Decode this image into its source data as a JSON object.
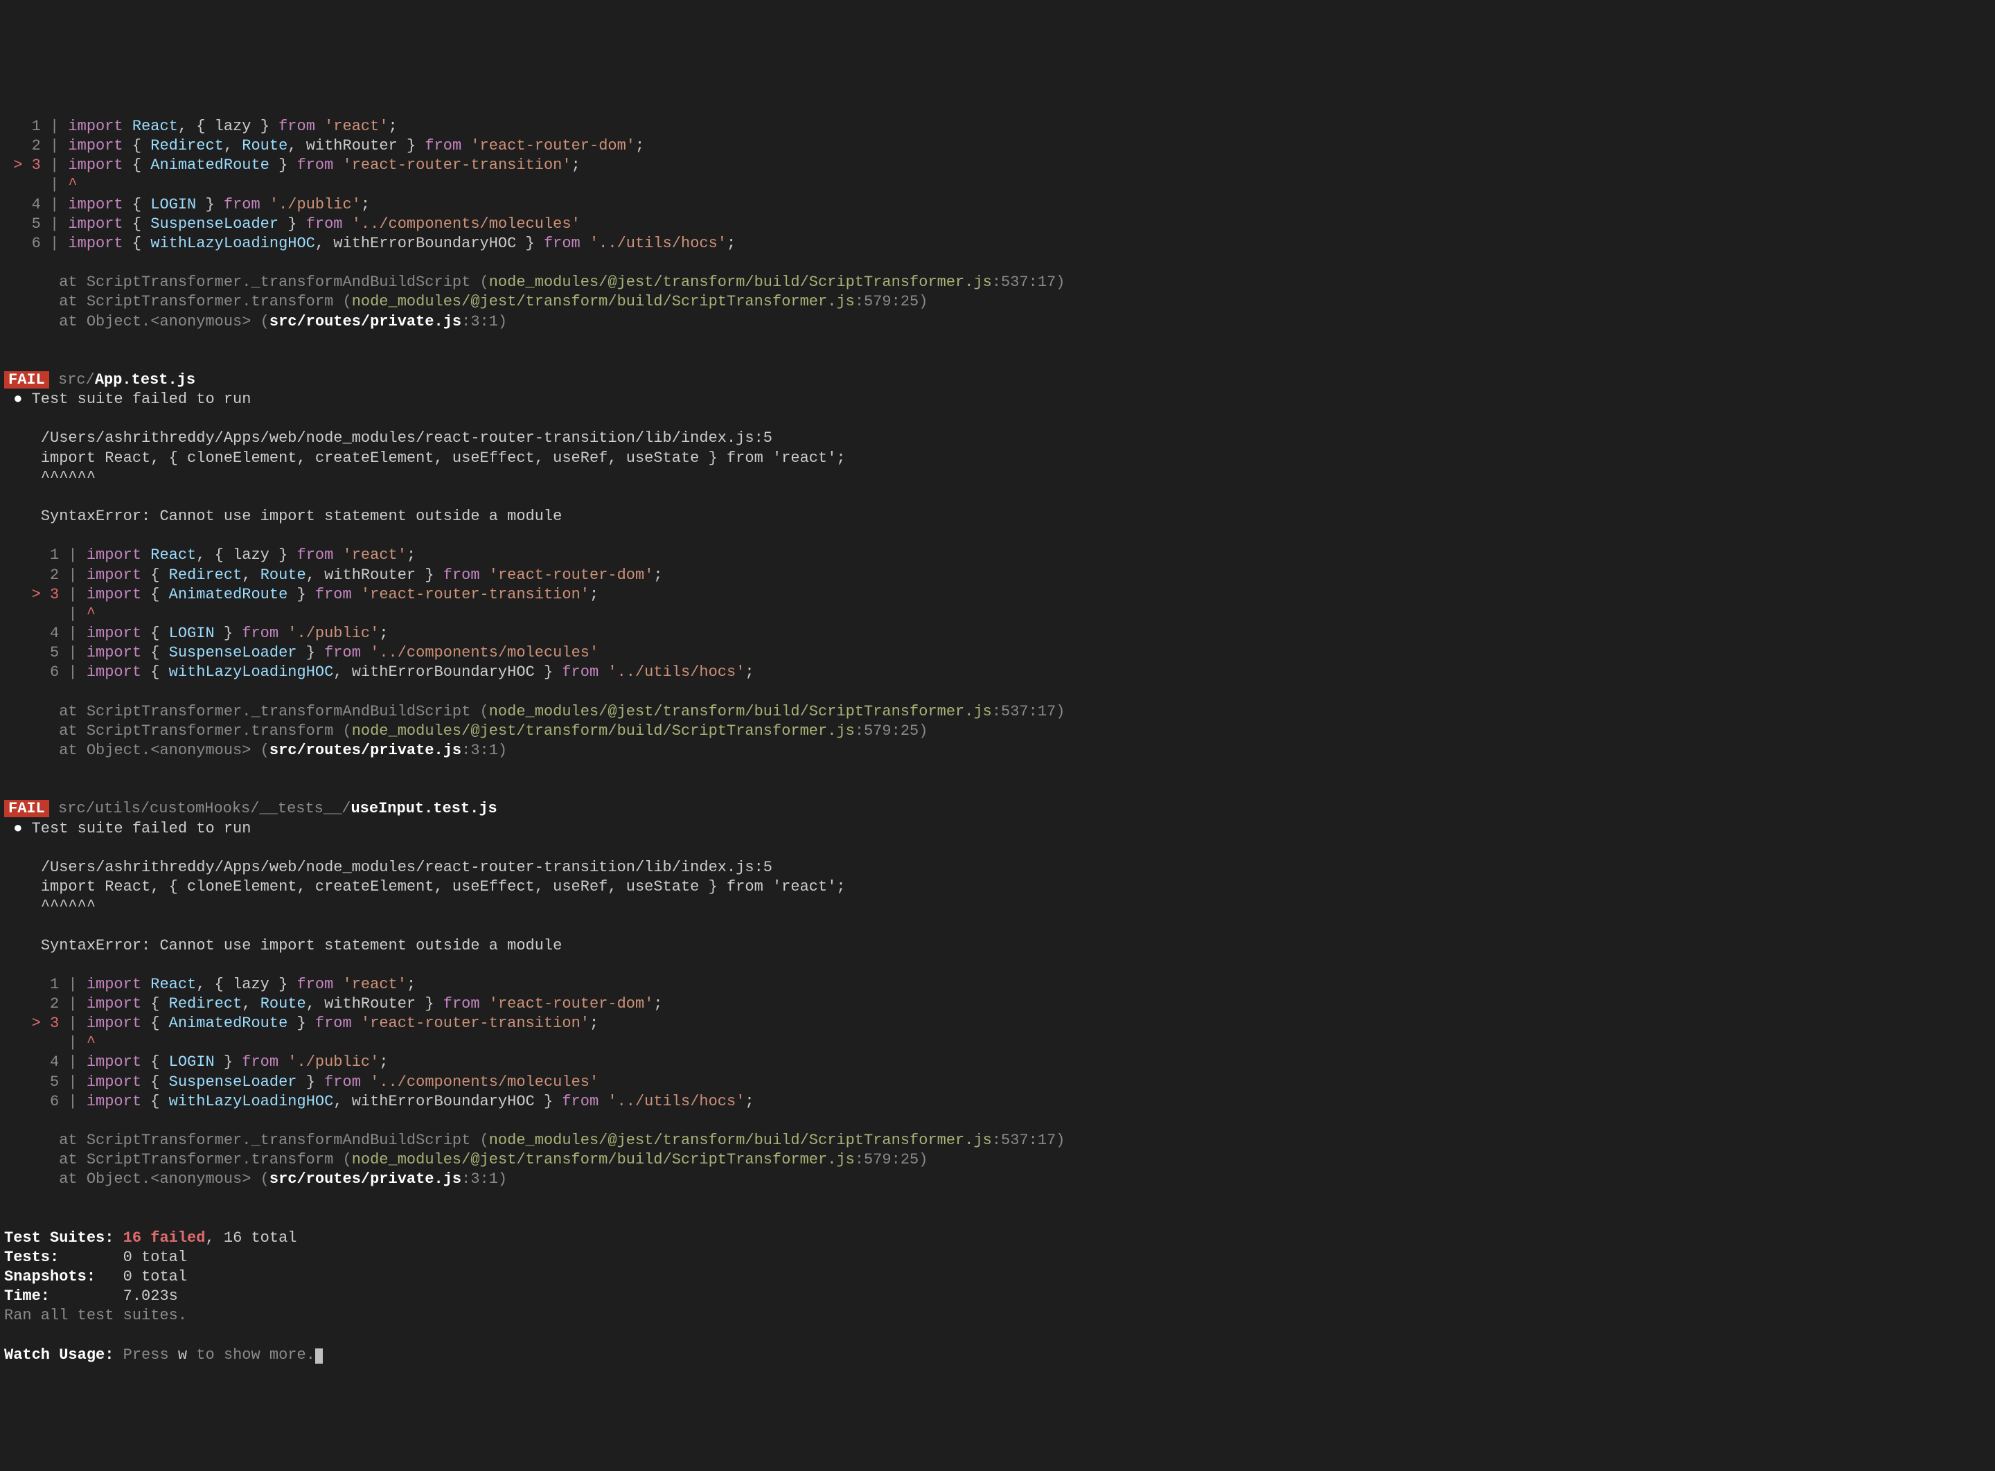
{
  "code": {
    "gutter": {
      "ln1": "   1",
      "ln2": "   2",
      "ln3": "   3",
      "ln4": "   4",
      "ln5": "   5",
      "ln6": "   6",
      "err": " > 3",
      "caret": "    "
    },
    "line1": {
      "import": "import",
      "react": "React",
      "comma": ",",
      "brace_o": " {",
      "lazy": " lazy ",
      "brace_c": "} ",
      "from": "from",
      "sp": " ",
      "str": "'react'",
      "semi": ";"
    },
    "line2": {
      "import": "import",
      "brace_o": " { ",
      "redirect": "Redirect",
      "route": "Route",
      "withRouter": " withRouter ",
      "brace_c": "} ",
      "from": "from",
      "str": "'react-router-dom'",
      "semi": ";"
    },
    "line3": {
      "import": "import",
      "brace_o": " { ",
      "anim": "AnimatedRoute ",
      "brace_c": "} ",
      "from": "from",
      "str": "'react-router-transition'",
      "semi": ";"
    },
    "caret": "^",
    "line4": {
      "import": "import",
      "brace_o": " { ",
      "login": "LOGIN ",
      "brace_c": "} ",
      "from": "from",
      "str": "'./public'",
      "semi": ";"
    },
    "line5": {
      "import": "import",
      "brace_o": " { ",
      "sus": "SuspenseLoader ",
      "brace_c": "} ",
      "from": "from",
      "str": "'../components/molecules'"
    },
    "line6": {
      "import": "import",
      "brace_o": " { ",
      "hoc1": "withLazyLoadingHOC",
      "hoc2": " withErrorBoundaryHOC ",
      "brace_c": "} ",
      "from": "from",
      "str": "'../utils/hocs'",
      "semi": ";"
    }
  },
  "stack": {
    "at": "at",
    "s1": {
      "fn": " ScriptTransformer._transformAndBuildScript (",
      "path": "node_modules/@jest/transform/build/ScriptTransformer.js",
      "loc": ":537:17)"
    },
    "s2": {
      "fn": " ScriptTransformer.transform (",
      "path": "node_modules/@jest/transform/build/ScriptTransformer.js",
      "loc": ":579:25)"
    },
    "s3": {
      "fn": " Object.<anonymous> (",
      "path": "src/routes/private.js",
      "loc": ":3:1)"
    }
  },
  "fail_label": "FAIL",
  "suite1": {
    "dir": " src/",
    "file": "App.test.js"
  },
  "suite2": {
    "dir": " src/utils/customHooks/__tests__/",
    "file": "useInput.test.js"
  },
  "suite_err_bullet": " ● ",
  "suite_err": "Test suite failed to run",
  "err_path": "/Users/ashrithreddy/Apps/web/node_modules/react-router-transition/lib/index.js:5",
  "err_imp": "import React, { cloneElement, createElement, useEffect, useRef, useState } from 'react';",
  "err_carets": "^^^^^^",
  "syntax_err": "SyntaxError: Cannot use import statement outside a module",
  "summary": {
    "suites_label": "Test Suites:",
    "suites_failed": " 16 failed",
    "suites_total": ", 16 total",
    "tests_label": "Tests:",
    "tests_val": "       0 total",
    "snap_label": "Snapshots:",
    "snap_val": "   0 total",
    "time_label": "Time:",
    "time_val": "        7.023s",
    "ran": "Ran all test suites."
  },
  "watch": {
    "label": "Watch Usage:",
    "press": " Press ",
    "key": "w",
    "rest": " to show more."
  }
}
